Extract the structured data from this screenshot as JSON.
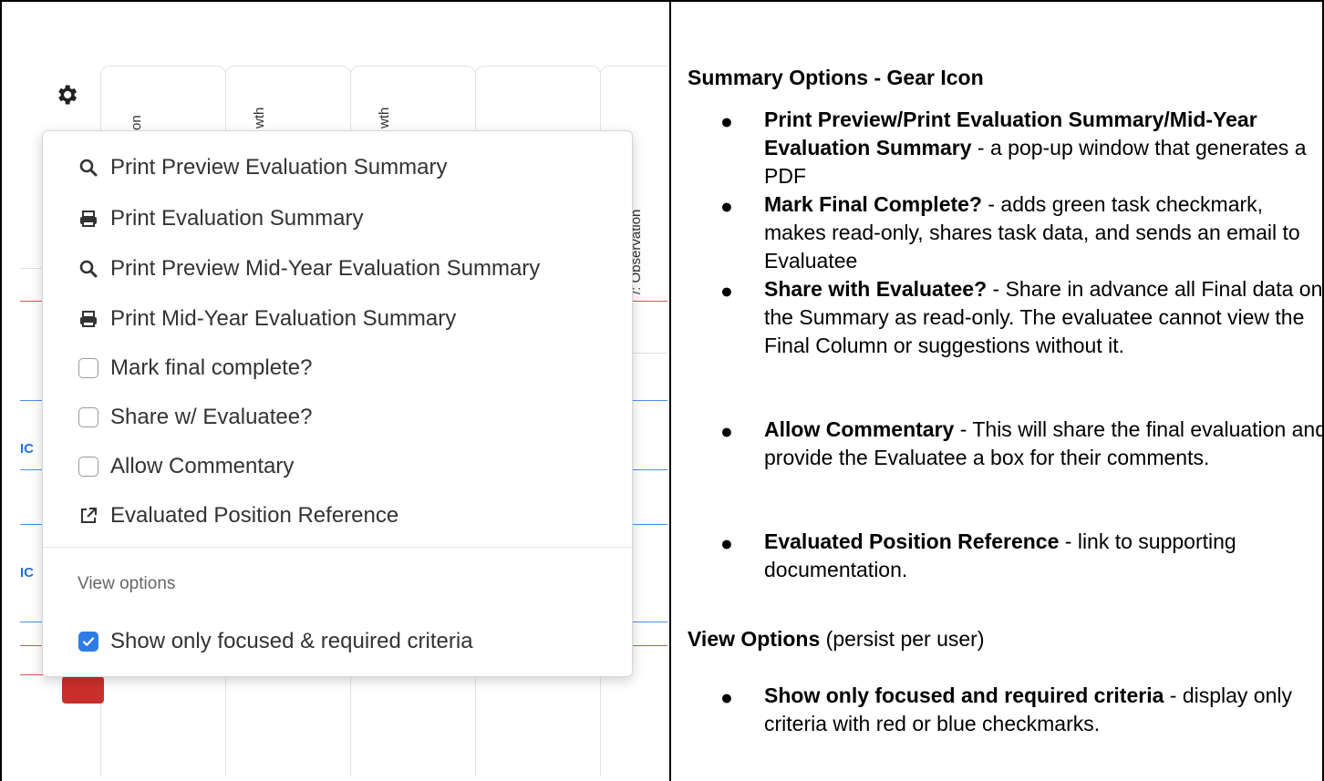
{
  "menu": {
    "items": [
      {
        "icon": "search-icon",
        "label": "Print Preview Evaluation Summary"
      },
      {
        "icon": "printer-icon",
        "label": "Print Evaluation Summary"
      },
      {
        "icon": "search-icon",
        "label": "Print Preview Mid-Year Evaluation Summary"
      },
      {
        "icon": "printer-icon",
        "label": "Print Mid-Year Evaluation Summary"
      },
      {
        "icon": "checkbox",
        "label": "Mark final complete?",
        "checked": false
      },
      {
        "icon": "checkbox",
        "label": "Share w/ Evaluatee?",
        "checked": false
      },
      {
        "icon": "checkbox",
        "label": "Allow Commentary",
        "checked": false
      },
      {
        "icon": "external-link-icon",
        "label": "Evaluated Position Reference"
      }
    ],
    "view_header": "View options",
    "view_item": {
      "label": "Show only focused & required criteria",
      "checked": true
    }
  },
  "background": {
    "col_fragments": [
      "on",
      "wth",
      "wth",
      "",
      "/: Observation"
    ],
    "left_fragments": [
      "IC",
      "IC"
    ]
  },
  "doc": {
    "title": "Summary Options - Gear Icon",
    "bullets": [
      {
        "bold": "Print Preview/Print Evaluation Summary/Mid-Year Evaluation Summary",
        "text": " - a pop-up window that generates a PDF"
      },
      {
        "bold": "Mark Final Complete?",
        "text": " - adds green task checkmark, makes read-only, shares task data, and sends an email to Evaluatee"
      },
      {
        "bold": "Share with Evaluatee?",
        "text": " - Share in advance all Final data on the Summary as read-only. The evaluatee cannot view the Final Column or suggestions without it."
      },
      {
        "bold": "Allow Commentary",
        "text": " - This will share the final evaluation and provide the Evaluatee a box for their comments."
      },
      {
        "bold": "Evaluated Position Reference",
        "text": " - link to supporting documentation."
      }
    ],
    "view_title": "View Options",
    "view_title_suffix": " (persist per user)",
    "view_bullets": [
      {
        "bold": "Show only focused and required criteria",
        "text": " - display only criteria with red or blue checkmarks."
      }
    ],
    "bullet_char": "●"
  }
}
